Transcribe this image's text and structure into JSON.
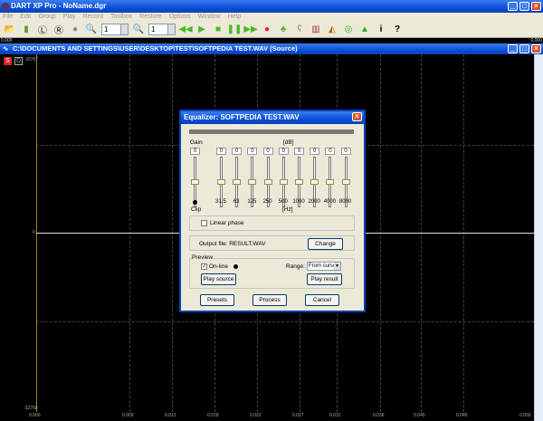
{
  "app": {
    "title": "DART XP Pro - NoName.dgr"
  },
  "menu": [
    "File",
    "Edit",
    "Group",
    "Play",
    "Record",
    "Toolbox",
    "Restore",
    "Options",
    "Window",
    "Help"
  ],
  "toolbar": {
    "zoom_in_value": "1",
    "zoom_out_value": "1",
    "info_label": "i",
    "help_label": "?"
  },
  "strip": {
    "left": "0.000",
    "right": "0.000"
  },
  "document": {
    "title": "C:\\DOCUMENTS AND SETTINGS\\USER\\DESKTOP\\TEST\\SOFTPEDIA TEST.WAV (Source)",
    "s_badge": "S",
    "d_badge": "D",
    "y_top": "32767",
    "y_mid": "0",
    "y_bottom": "-32768",
    "x_ticks": [
      "0.000",
      "0.009",
      "0.013",
      "0.018",
      "0.022",
      "0.027",
      "0.031",
      "0.036",
      "0.040",
      "0.045",
      "0.050"
    ]
  },
  "dialog": {
    "title": "Equalizer: SOFTPEDIA TEST.WAV",
    "gain_label": "Gain",
    "db_label": "[dB]",
    "hz_label": "[Hz]",
    "clip_label": "Clip",
    "gain_value": "0",
    "bands": [
      {
        "freq": "31.5",
        "value": "0"
      },
      {
        "freq": "63",
        "value": "0"
      },
      {
        "freq": "125",
        "value": "0"
      },
      {
        "freq": "250",
        "value": "0"
      },
      {
        "freq": "500",
        "value": "0"
      },
      {
        "freq": "1000",
        "value": "0"
      },
      {
        "freq": "2000",
        "value": "0"
      },
      {
        "freq": "4000",
        "value": "0"
      },
      {
        "freq": "8000",
        "value": "0"
      }
    ],
    "linear_phase": "Linear phase",
    "output_file": "Output file: RESULT.WAV",
    "change": "Change",
    "preview": "Preview",
    "online": "On-line",
    "range_label": "Range:",
    "range_value": "From cursor",
    "play_source": "Play source",
    "play_result": "Play result",
    "presets": "Presets",
    "process": "Process",
    "cancel": "Cancel"
  }
}
